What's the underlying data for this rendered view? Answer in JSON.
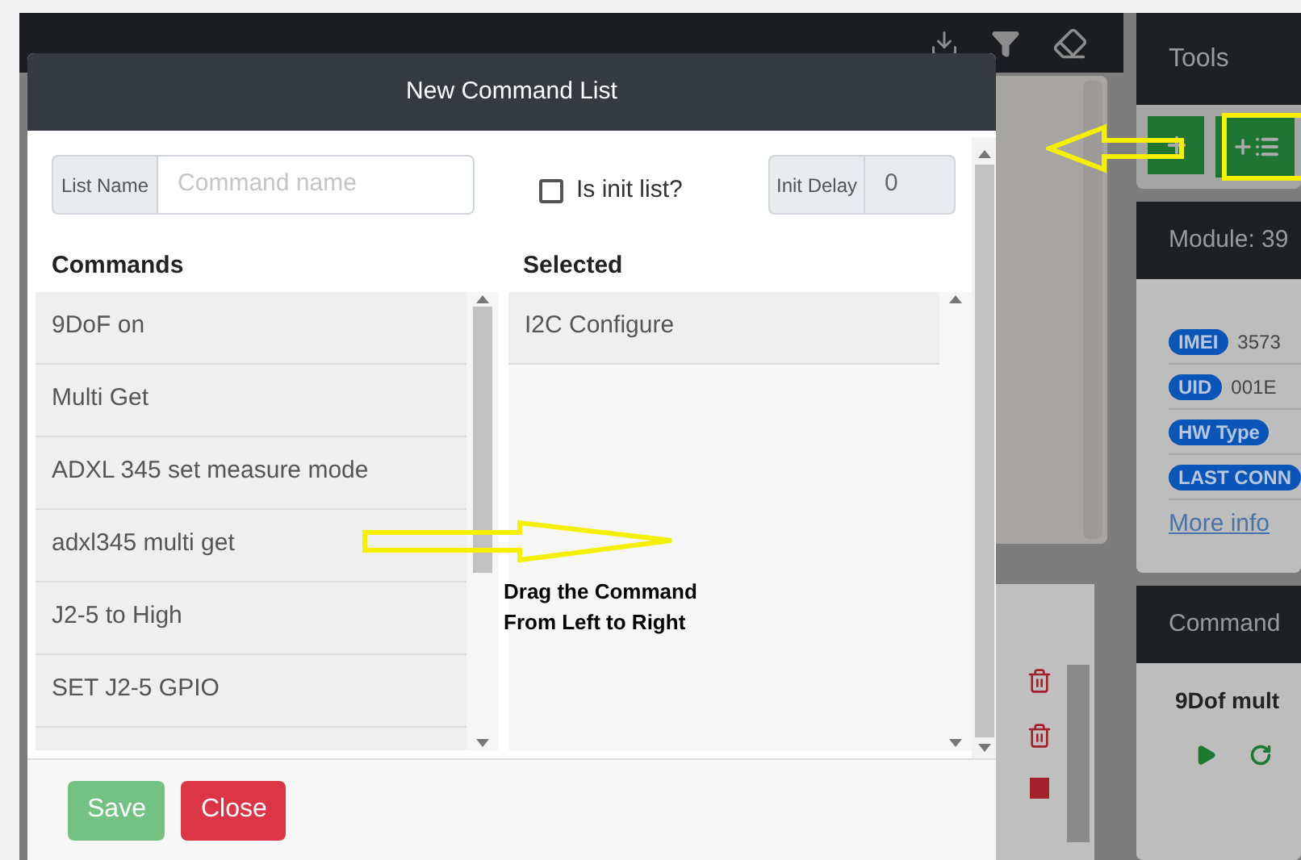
{
  "toolbar": {
    "title": "Tools"
  },
  "module": {
    "title": "Module: 39",
    "info": [
      {
        "label": "IMEI",
        "value": "3573"
      },
      {
        "label": "UID",
        "value": "001E"
      },
      {
        "label": "HW Type"
      },
      {
        "label": "LAST CONN"
      }
    ],
    "link": "More info"
  },
  "command_panel": {
    "title": "Command",
    "item": "9Dof mult"
  },
  "dialog": {
    "title": "New Command List",
    "list_name": {
      "label": "List Name",
      "placeholder": "Command name"
    },
    "init_list": {
      "label": "Is init list?",
      "checked": false
    },
    "init_delay": {
      "label": "Init Delay",
      "value": "0"
    },
    "commands": {
      "heading": "Commands",
      "items": [
        "9DoF on",
        "Multi Get",
        "ADXL 345 set measure mode",
        "adxl345 multi get",
        "J2-5 to High",
        "SET J2-5 GPIO"
      ]
    },
    "selected": {
      "heading": "Selected",
      "items": [
        "I2C Configure"
      ]
    },
    "buttons": [
      {
        "label": "Save",
        "kind": "save"
      },
      {
        "label": "Close",
        "kind": "close"
      }
    ]
  },
  "annotation": {
    "lines": [
      "Drag the Command",
      "From Left to Right"
    ]
  }
}
